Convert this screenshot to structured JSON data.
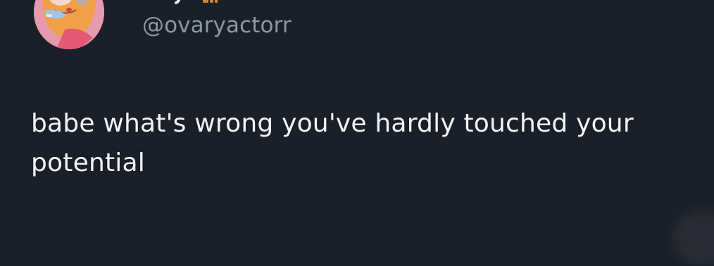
{
  "tweet": {
    "handle": "@ovaryactorr",
    "text": "babe what's wrong you've hardly touched your potential",
    "avatar_icon": "cartoon-profile-avatar"
  },
  "colors": {
    "background": "#1a1f28",
    "handle": "#8b98a5",
    "text": "#f1f3f5",
    "avatar_bg": "#e69aae"
  }
}
